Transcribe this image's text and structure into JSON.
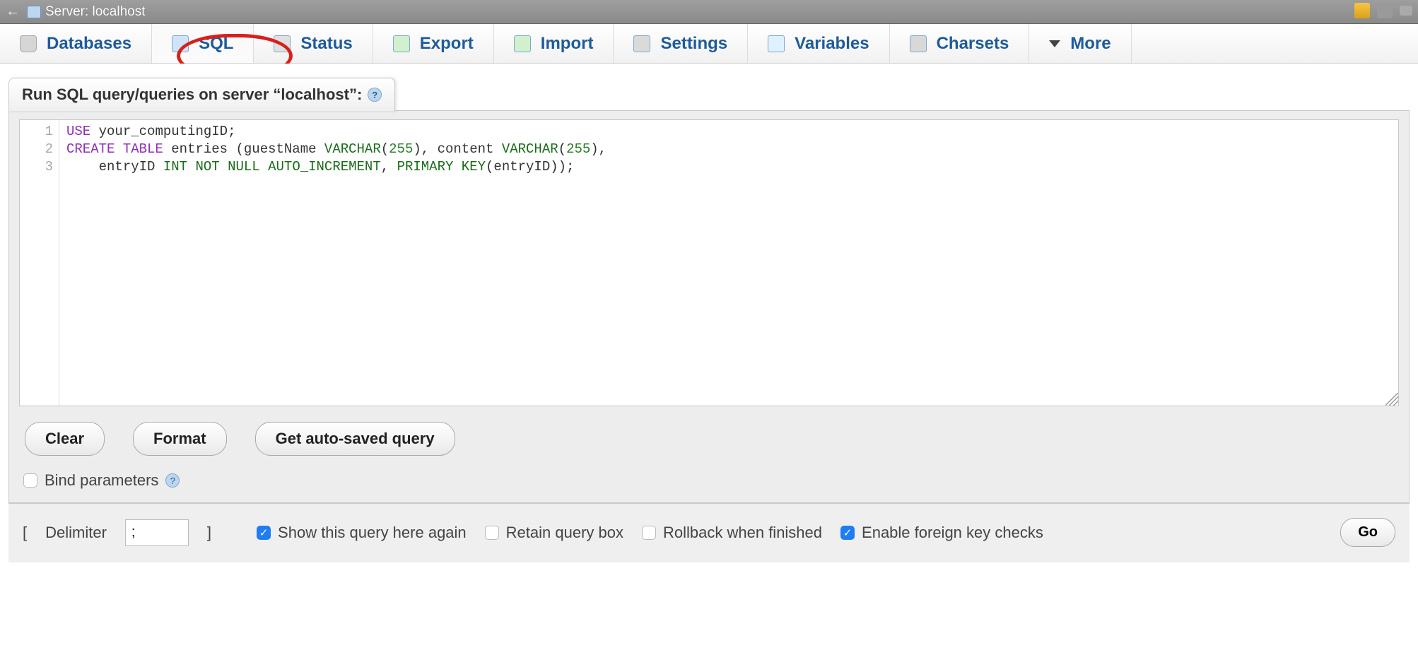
{
  "topbar": {
    "title": "Server: localhost"
  },
  "tabs": {
    "databases": "Databases",
    "sql": "SQL",
    "status": "Status",
    "export": "Export",
    "import": "Import",
    "settings": "Settings",
    "variables": "Variables",
    "charsets": "Charsets",
    "more": "More",
    "active": "sql"
  },
  "panel": {
    "heading": "Run SQL query/queries on server “localhost”:"
  },
  "editor": {
    "line_numbers": [
      "1",
      "2",
      "3"
    ],
    "tokens": [
      {
        "t": "kw",
        "v": "USE"
      },
      {
        "t": "sp",
        "v": " "
      },
      {
        "t": "id",
        "v": "your_computingID"
      },
      {
        "t": "pu",
        "v": ";"
      },
      {
        "t": "nl",
        "v": "\n"
      },
      {
        "t": "kw",
        "v": "CREATE"
      },
      {
        "t": "sp",
        "v": " "
      },
      {
        "t": "kw",
        "v": "TABLE"
      },
      {
        "t": "sp",
        "v": " "
      },
      {
        "t": "id",
        "v": "entries"
      },
      {
        "t": "sp",
        "v": " "
      },
      {
        "t": "pu",
        "v": "("
      },
      {
        "t": "id",
        "v": "guestName"
      },
      {
        "t": "sp",
        "v": " "
      },
      {
        "t": "ty",
        "v": "VARCHAR"
      },
      {
        "t": "pu",
        "v": "("
      },
      {
        "t": "num",
        "v": "255"
      },
      {
        "t": "pu",
        "v": ")"
      },
      {
        "t": "pu",
        "v": ","
      },
      {
        "t": "sp",
        "v": " "
      },
      {
        "t": "id",
        "v": "content"
      },
      {
        "t": "sp",
        "v": " "
      },
      {
        "t": "ty",
        "v": "VARCHAR"
      },
      {
        "t": "pu",
        "v": "("
      },
      {
        "t": "num",
        "v": "255"
      },
      {
        "t": "pu",
        "v": ")"
      },
      {
        "t": "pu",
        "v": ","
      },
      {
        "t": "nl",
        "v": "\n"
      },
      {
        "t": "sp",
        "v": "    "
      },
      {
        "t": "id",
        "v": "entryID"
      },
      {
        "t": "sp",
        "v": " "
      },
      {
        "t": "ty",
        "v": "INT"
      },
      {
        "t": "sp",
        "v": " "
      },
      {
        "t": "ty",
        "v": "NOT"
      },
      {
        "t": "sp",
        "v": " "
      },
      {
        "t": "ty",
        "v": "NULL"
      },
      {
        "t": "sp",
        "v": " "
      },
      {
        "t": "ty",
        "v": "AUTO_INCREMENT"
      },
      {
        "t": "pu",
        "v": ","
      },
      {
        "t": "sp",
        "v": " "
      },
      {
        "t": "ty",
        "v": "PRIMARY"
      },
      {
        "t": "sp",
        "v": " "
      },
      {
        "t": "ty",
        "v": "KEY"
      },
      {
        "t": "pu",
        "v": "("
      },
      {
        "t": "id",
        "v": "entryID"
      },
      {
        "t": "pu",
        "v": ")"
      },
      {
        "t": "pu",
        "v": ")"
      },
      {
        "t": "pu",
        "v": ";"
      }
    ]
  },
  "buttons": {
    "clear": "Clear",
    "format": "Format",
    "get_autosaved": "Get auto-saved query",
    "go": "Go"
  },
  "bind_params": {
    "label": "Bind parameters",
    "checked": false
  },
  "footer": {
    "delimiter_label": "Delimiter",
    "delimiter_value": ";",
    "show_again": {
      "label": "Show this query here again",
      "checked": true
    },
    "retain": {
      "label": "Retain query box",
      "checked": false
    },
    "rollback": {
      "label": "Rollback when finished",
      "checked": false
    },
    "fk_checks": {
      "label": "Enable foreign key checks",
      "checked": true
    }
  }
}
